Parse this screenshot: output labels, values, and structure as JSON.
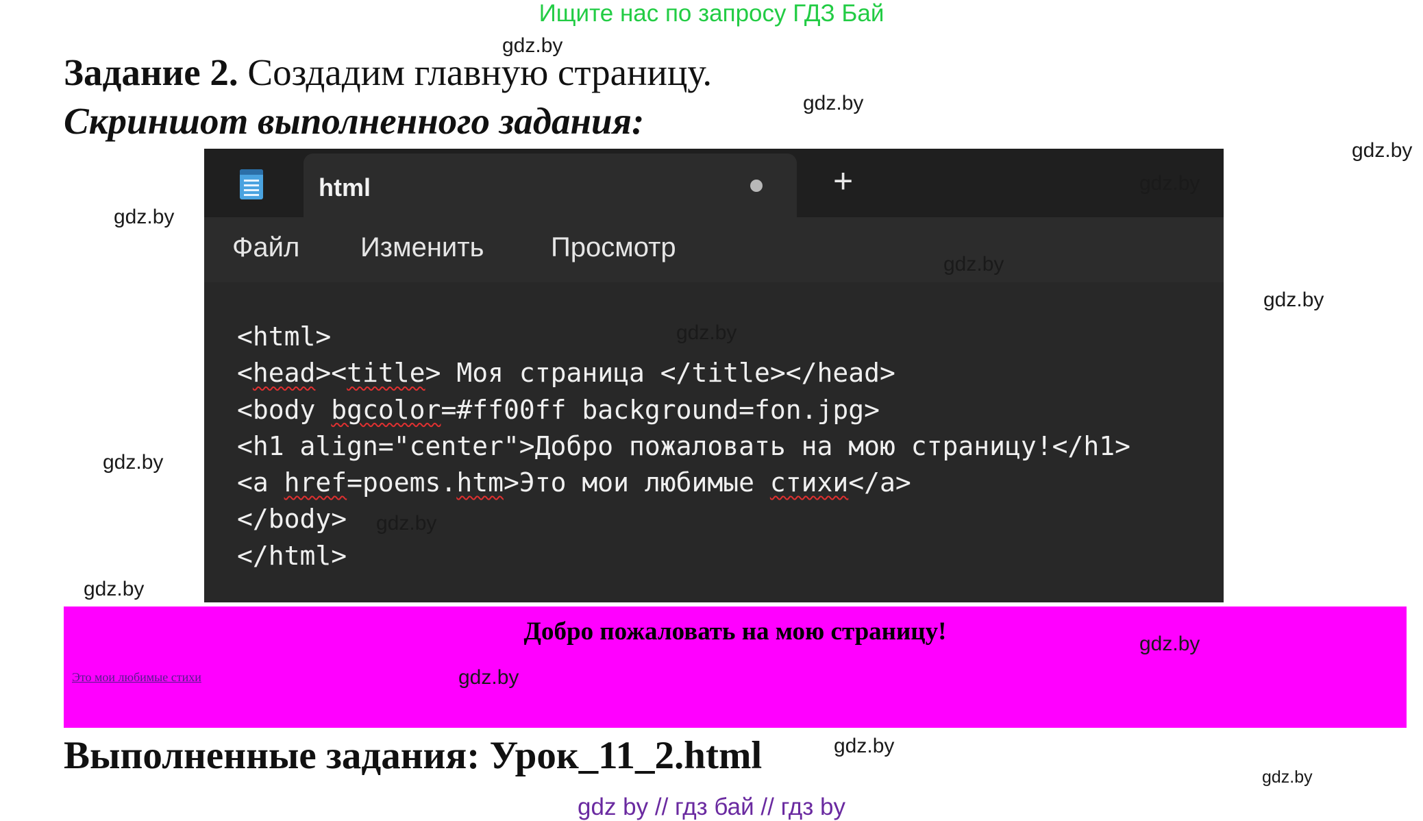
{
  "banner": "Ищите нас по запросу ГДЗ Бай",
  "watermark": "gdz.by",
  "task": {
    "label": "Задание 2.",
    "text": "Создадим главную страницу."
  },
  "subtitle": "Скриншот выполненного задания:",
  "editor": {
    "tab_title": "html",
    "new_tab": "+",
    "menu": [
      "Файл",
      "Изменить",
      "Просмотр"
    ],
    "code_lines": [
      [
        {
          "t": "<html>"
        }
      ],
      [
        {
          "t": "<"
        },
        {
          "t": "head",
          "s": true
        },
        {
          "t": "><"
        },
        {
          "t": "title",
          "s": true
        },
        {
          "t": "> Моя страница </title></head>"
        }
      ],
      [
        {
          "t": "<body "
        },
        {
          "t": "bgcolor",
          "s": true
        },
        {
          "t": "=#ff00ff background=fon.jpg>"
        }
      ],
      [
        {
          "t": "<h1 align=\"center\">Добро пожаловать на мою страницу!</h1>"
        }
      ],
      [
        {
          "t": "<a "
        },
        {
          "t": "href",
          "s": true
        },
        {
          "t": "=poems."
        },
        {
          "t": "htm",
          "s": true
        },
        {
          "t": ">Это мои любимые "
        },
        {
          "t": "стихи",
          "s": true
        },
        {
          "t": "</a>"
        }
      ],
      [
        {
          "t": "</body>"
        }
      ],
      [
        {
          "t": "</html>"
        }
      ]
    ]
  },
  "rendered_page": {
    "background": "#ff00ff",
    "heading": "Добро пожаловать на мою страницу!",
    "link": "Это мои любимые стихи"
  },
  "completed": "Выполненные задания: Урок_11_2.html",
  "footer": "gdz by  //  гдз бай  //  гдз by"
}
